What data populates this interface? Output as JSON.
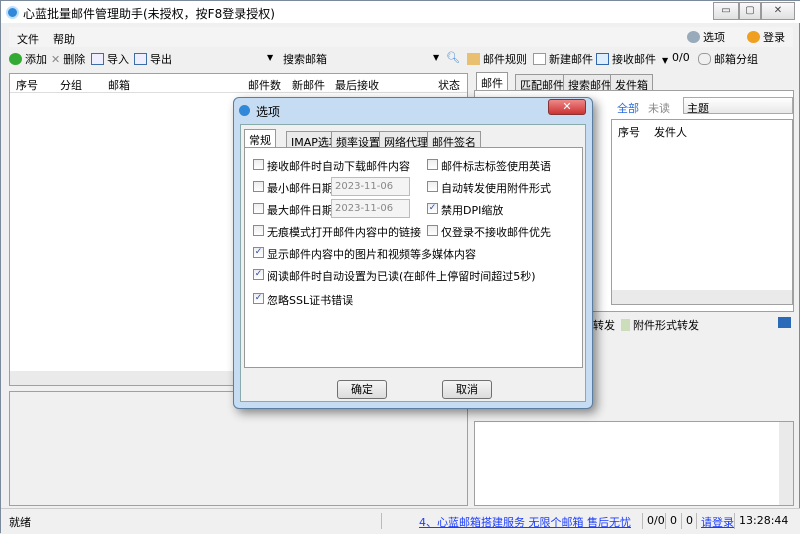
{
  "window": {
    "title": "心蓝批量邮件管理助手(未授权，按F8登录授权)",
    "min": "▭",
    "max": "▢",
    "close": "✕"
  },
  "menu": [
    "文件",
    "帮助"
  ],
  "top_right": {
    "options": "选项",
    "login": "登录"
  },
  "toolbar": {
    "add": "添加",
    "delete": "删除",
    "import": "导入",
    "export": "导出",
    "search_placeholder": "搜索邮箱",
    "mail_rules": "邮件规则",
    "new_mail": "新建邮件",
    "receive_mail": "接收邮件",
    "count": "0/0",
    "mailbox_group": "邮箱分组"
  },
  "left_table": {
    "columns": [
      "序号",
      "分组",
      "邮箱",
      "邮件数",
      "新邮件",
      "最后接收",
      "状态"
    ]
  },
  "right": {
    "tabs": [
      "邮件",
      "匹配邮件",
      "搜索邮件",
      "发件箱"
    ],
    "filter_all": "全部",
    "filter_unread": "未读",
    "subject_field": "主题",
    "columns": [
      "序号",
      "发件人"
    ],
    "forward": "转发",
    "attach_forward": "附件形式转发"
  },
  "status": {
    "ready": "就绪",
    "ad_link": "4、心蓝邮箱搭建服务 无限个邮箱 售后无忧",
    "c1": "0/0",
    "c2": "0",
    "c3": "0",
    "login_link": "请登录",
    "time": "13:28:44"
  },
  "dialog": {
    "title": "选项",
    "close": "✕",
    "tabs": [
      "常规",
      "IMAP选项",
      "频率设置",
      "网络代理",
      "邮件签名"
    ],
    "options": [
      {
        "label": "接收邮件时自动下载邮件内容",
        "checked": false
      },
      {
        "label": "邮件标志标签使用英语",
        "checked": false
      },
      {
        "label": "最小邮件日期",
        "checked": false,
        "date": "2023-11-06"
      },
      {
        "label": "自动转发使用附件形式",
        "checked": false
      },
      {
        "label": "最大邮件日期",
        "checked": false,
        "date": "2023-11-06"
      },
      {
        "label": "禁用DPI缩放",
        "checked": true
      },
      {
        "label": "无痕模式打开邮件内容中的链接",
        "checked": false
      },
      {
        "label": "仅登录不接收邮件优先",
        "checked": false
      },
      {
        "label": "显示邮件内容中的图片和视频等多媒体内容",
        "checked": true
      },
      {
        "label": "阅读邮件时自动设置为已读(在邮件上停留时间超过5秒)",
        "checked": true
      },
      {
        "label": "忽略SSL证书错误",
        "checked": true
      }
    ],
    "ok": "确定",
    "cancel": "取消"
  }
}
